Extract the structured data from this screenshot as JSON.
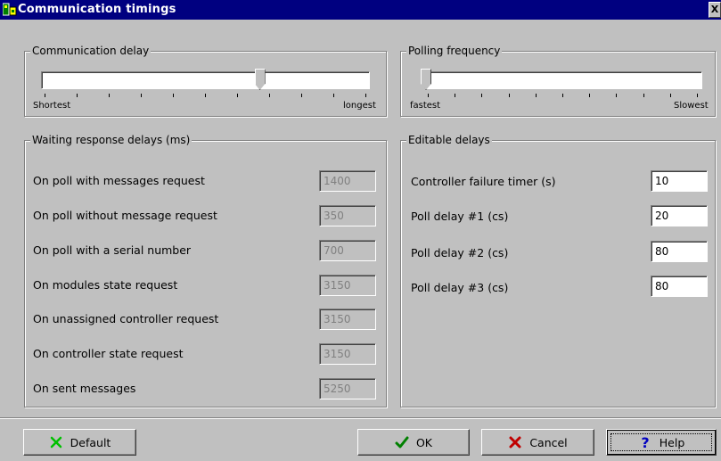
{
  "window": {
    "title": "Communication timings",
    "close_glyph": "X"
  },
  "communication_delay": {
    "title": "Communication delay",
    "min_label": "Shortest",
    "max_label": "longest",
    "position": 0.66
  },
  "polling_frequency": {
    "title": "Polling frequency",
    "min_label": "fastest",
    "max_label": "Slowest",
    "position": 0.0
  },
  "waiting_delays": {
    "title": "Waiting response delays (ms)",
    "rows": [
      {
        "label": "On poll with messages request",
        "value": "1400"
      },
      {
        "label": "On poll without message request",
        "value": "350"
      },
      {
        "label": "On poll with a serial number",
        "value": "700"
      },
      {
        "label": "On modules state request",
        "value": "3150"
      },
      {
        "label": "On unassigned controller request",
        "value": "3150"
      },
      {
        "label": "On controller state request",
        "value": "3150"
      },
      {
        "label": "On sent messages",
        "value": "5250"
      }
    ]
  },
  "editable_delays": {
    "title": "Editable delays",
    "rows": [
      {
        "label": "Controller failure timer (s)",
        "value": "10"
      },
      {
        "label": "Poll delay #1 (cs)",
        "value": "20"
      },
      {
        "label": "Poll delay #2 (cs)",
        "value": "80"
      },
      {
        "label": "Poll delay #3 (cs)",
        "value": "80"
      }
    ]
  },
  "buttons": {
    "default": {
      "label": "Default",
      "icon": "green-x-icon"
    },
    "ok": {
      "label": "OK",
      "icon": "checkmark-icon"
    },
    "cancel": {
      "label": "Cancel",
      "icon": "red-x-icon"
    },
    "help": {
      "label": "Help",
      "icon": "question-mark-icon"
    }
  },
  "colors": {
    "titlebar": "#000080",
    "face": "#c0c0c0",
    "disabled_text": "#808080",
    "ok_green": "#008000",
    "cancel_red": "#c00000",
    "help_blue": "#0000c0"
  }
}
